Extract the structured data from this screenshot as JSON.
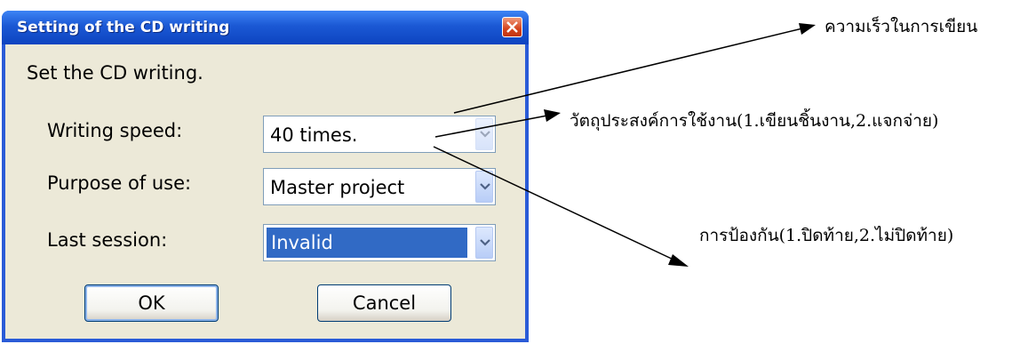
{
  "dialog": {
    "title": "Setting of the CD writing",
    "instruction": "Set the CD writing.",
    "fields": [
      {
        "label": "Writing speed:",
        "value": "40 times."
      },
      {
        "label": "Purpose of use:",
        "value": "Master project"
      },
      {
        "label": "Last session:",
        "value": "Invalid"
      }
    ],
    "ok_label": "OK",
    "cancel_label": "Cancel",
    "close_icon": "close-x-icon"
  },
  "annotations": [
    "ความเร็วในการเขียน",
    "วัตถุประสงค์การใช้งาน(1.เขียนชิ้นงาน,2.แจกจ่าย)",
    "การป้องกัน(1.ปิดท้าย,2.ไม่ปิดท้าย)"
  ],
  "colors": {
    "titlebar": "#1b58d4",
    "dialog_bg": "#ece9d8",
    "selection": "#316ac5",
    "close_button": "#d4421c"
  }
}
